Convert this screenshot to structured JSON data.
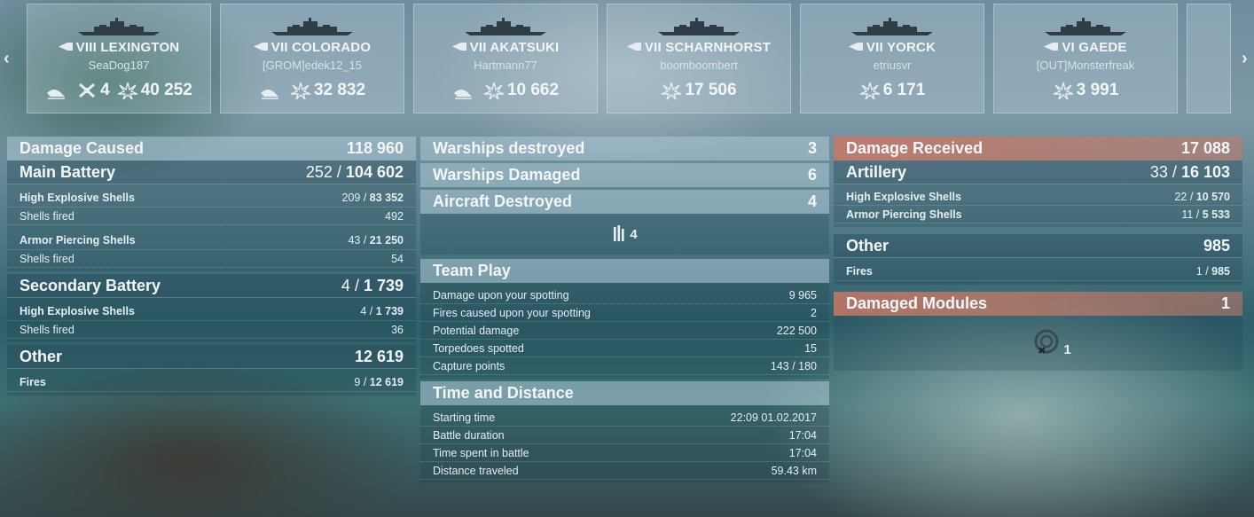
{
  "nav": {
    "prev": "‹",
    "next": "›"
  },
  "cards": [
    {
      "tier": "VIII",
      "name": "LEXINGTON",
      "player": "SeaDog187",
      "class_icon": "carrier-class-icon",
      "stats": [
        {
          "icon": "torpedo-hit-icon",
          "value": ""
        },
        {
          "icon": "planes-destroyed-icon",
          "value": "4"
        },
        {
          "icon": "damage-icon",
          "value": "40 252"
        }
      ]
    },
    {
      "tier": "VII",
      "name": "COLORADO",
      "player": "[GROM]edek12_15",
      "class_icon": "battleship-class-icon",
      "stats": [
        {
          "icon": "torpedo-hit-icon",
          "value": ""
        },
        {
          "icon": "damage-icon",
          "value": "32 832"
        }
      ]
    },
    {
      "tier": "VII",
      "name": "AKATSUKI",
      "player": "Hartmann77",
      "class_icon": "destroyer-class-icon",
      "stats": [
        {
          "icon": "torpedo-hit-icon",
          "value": ""
        },
        {
          "icon": "damage-icon",
          "value": "10 662"
        }
      ]
    },
    {
      "tier": "VII",
      "name": "SCHARNHORST",
      "player": "boomboombert",
      "class_icon": "battleship-class-icon",
      "stats": [
        {
          "icon": "damage-icon",
          "value": "17 506"
        }
      ]
    },
    {
      "tier": "VII",
      "name": "YORCK",
      "player": "etriusvr",
      "class_icon": "cruiser-class-icon",
      "stats": [
        {
          "icon": "damage-icon",
          "value": "6 171"
        }
      ]
    },
    {
      "tier": "VI",
      "name": "GAEDE",
      "player": "[OUT]Monsterfreak",
      "class_icon": "destroyer-class-icon",
      "stats": [
        {
          "icon": "damage-icon",
          "value": "3 991"
        }
      ]
    }
  ],
  "left": {
    "damage_caused": {
      "label": "Damage Caused",
      "value": "118 960"
    },
    "main_battery": {
      "label": "Main Battery",
      "hits": "252",
      "sep": " / ",
      "damage": "104 602"
    },
    "main_he": {
      "label": "High Explosive Shells",
      "hits": "209",
      "damage": "83 352"
    },
    "main_he_fired": {
      "label": "Shells fired",
      "value": "492"
    },
    "main_ap": {
      "label": "Armor Piercing Shells",
      "hits": "43",
      "damage": "21 250"
    },
    "main_ap_fired": {
      "label": "Shells fired",
      "value": "54"
    },
    "secondary": {
      "label": "Secondary Battery",
      "hits": "4",
      "damage": "1 739"
    },
    "sec_he": {
      "label": "High Explosive Shells",
      "hits": "4",
      "damage": "1 739"
    },
    "sec_he_fired": {
      "label": "Shells fired",
      "value": "36"
    },
    "other": {
      "label": "Other",
      "value": "12 619"
    },
    "fires": {
      "label": "Fires",
      "hits": "9",
      "damage": "12 619"
    }
  },
  "middle": {
    "warships_destroyed": {
      "label": "Warships destroyed",
      "value": "3"
    },
    "warships_damaged": {
      "label": "Warships Damaged",
      "value": "6"
    },
    "aircraft_destroyed": {
      "label": "Aircraft Destroyed",
      "value": "4"
    },
    "aircraft_icon_count": "4",
    "team_play": {
      "title": "Team Play",
      "rows": [
        {
          "label": "Damage upon your spotting",
          "value": "9 965"
        },
        {
          "label": "Fires caused upon your spotting",
          "value": "2"
        },
        {
          "label": "Potential damage",
          "value": "222 500"
        },
        {
          "label": "Torpedoes spotted",
          "value": "15"
        },
        {
          "label": "Capture points",
          "value": "143 / 180"
        }
      ]
    },
    "time_distance": {
      "title": "Time and Distance",
      "rows": [
        {
          "label": "Starting time",
          "value": "22:09  01.02.2017"
        },
        {
          "label": "Battle duration",
          "value": "17:04"
        },
        {
          "label": "Time spent in battle",
          "value": "17:04"
        },
        {
          "label": "Distance traveled",
          "value": "59.43 km"
        }
      ]
    }
  },
  "right": {
    "damage_received": {
      "label": "Damage Received",
      "value": "17 088"
    },
    "artillery": {
      "label": "Artillery",
      "hits": "33",
      "damage": "16 103"
    },
    "he": {
      "label": "High Explosive Shells",
      "hits": "22",
      "damage": "10 570"
    },
    "ap": {
      "label": "Armor Piercing Shells",
      "hits": "11",
      "damage": "5 533"
    },
    "other": {
      "label": "Other",
      "value": "985"
    },
    "fires": {
      "label": "Fires",
      "hits": "1",
      "damage": "985"
    },
    "damaged_modules": {
      "label": "Damaged Modules",
      "value": "1"
    },
    "module_icon_count": "1"
  },
  "colors": {
    "header_blue": "#afc8d7",
    "header_red": "#c87864",
    "text": "#e8eef2"
  }
}
